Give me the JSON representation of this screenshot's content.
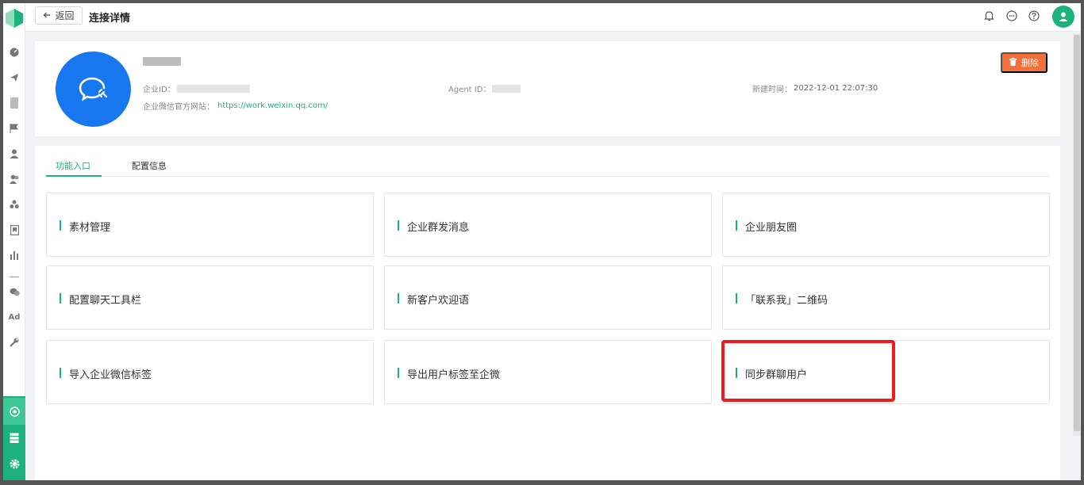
{
  "header": {
    "back_label": "返回",
    "title": "连接详情"
  },
  "info": {
    "corp_id_label": "企业ID：",
    "agent_id_label": "Agent ID：",
    "created_label": "新建时间：",
    "created_value": "2022-12-01 22:07:30",
    "site_label": "企业微信官方网站：",
    "site_url": "https://work.weixin.qq.com/",
    "delete_label": "删除"
  },
  "tabs": [
    {
      "label": "功能入口",
      "active": true
    },
    {
      "label": "配置信息",
      "active": false
    }
  ],
  "functions": [
    {
      "label": "素材管理"
    },
    {
      "label": "企业群发消息"
    },
    {
      "label": "企业朋友圈"
    },
    {
      "label": "配置聊天工具栏"
    },
    {
      "label": "新客户欢迎语"
    },
    {
      "label": "「联系我」二维码"
    },
    {
      "label": "导入企业微信标签"
    },
    {
      "label": "导出用户标签至企微"
    },
    {
      "label": "同步群聊用户"
    }
  ],
  "colors": {
    "accent": "#1cb27c",
    "danger": "#f56f3b",
    "wecom_blue": "#1677f0",
    "highlight": "#ee1c1c"
  },
  "icons": {
    "sidebar": [
      "dashboard-icon",
      "send-icon",
      "doc-icon",
      "flag-icon",
      "user-icon",
      "users-icon",
      "group-icon",
      "bookmark-icon",
      "chart-icon",
      "wechat-icon",
      "ad-icon",
      "wrench-icon"
    ],
    "sidebar_bottom": [
      "connect-icon",
      "server-icon",
      "settings-icon"
    ]
  }
}
